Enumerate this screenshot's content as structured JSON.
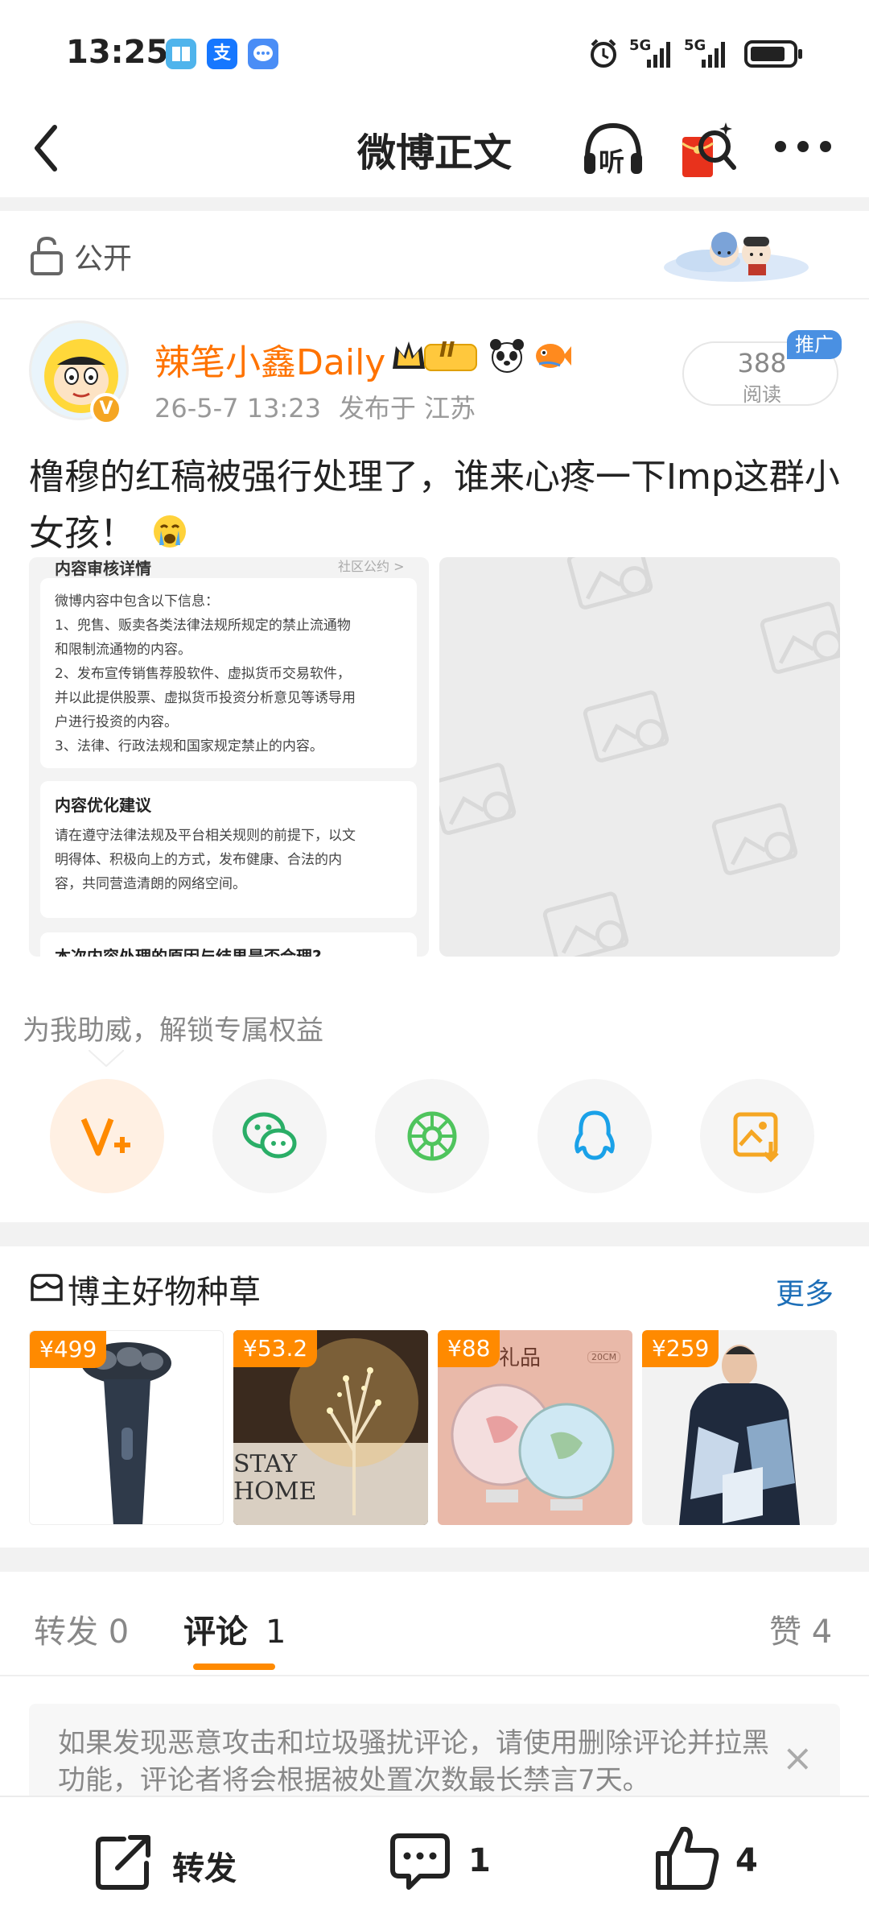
{
  "status_bar": {
    "time": "13:25",
    "app_icons": [
      {
        "name": "book-icon",
        "glyph": "▥",
        "color": "#4fb4ec"
      },
      {
        "name": "alipay-icon",
        "glyph": "支",
        "color": "#1677ff"
      },
      {
        "name": "message-icon",
        "glyph": "…",
        "color": "#4a8df6"
      }
    ],
    "network_1": "5G",
    "network_2": "5G"
  },
  "navbar": {
    "title": "微博正文",
    "listen_label": "听"
  },
  "post": {
    "visibility": "公开",
    "author": "辣笔小鑫Daily",
    "level_badge": "II",
    "date": "26-5-7 13:23",
    "location": "发布于 江苏",
    "read_count": "388",
    "read_label": "阅读",
    "promo_tag": "推广",
    "text": "橹穆的红稿被强行处理了，谁来心疼一下Imp这群小女孩！",
    "image_left": {
      "header_text": "内容审核详情",
      "header_link": "社区公约 >",
      "card1_lines": [
        "微博内容中包含以下信息：",
        "1、兜售、贩卖各类法律法规所规定的禁止流通物",
        "和限制流通物的内容。",
        "2、发布宣传销售荐股软件、虚拟货币交易软件，",
        "并以此提供股票、虚拟货币投资分析意见等诱导用",
        "户进行投资的内容。",
        "3、法律、行政法规和国家规定禁止的内容。"
      ],
      "card2_title": "内容优化建议",
      "card2_lines": [
        "请在遵守法律法规及平台相关规则的前提下，以文",
        "明得体、积极向上的方式，发布健康、合法的内",
        "容，共同营造清朗的网络空间。"
      ],
      "card3_title": "本次内容处理的原因与结果是否合理?"
    }
  },
  "boost": {
    "text": "为我助威，解锁专属权益"
  },
  "goods": {
    "title": "博主好物种草",
    "more": "更多",
    "items": [
      {
        "price": "¥499"
      },
      {
        "price": "¥53.2",
        "overlay_text": "STAY HOME"
      },
      {
        "price": "¥88",
        "overlay_text": "礼品",
        "size_tag": "20CM"
      },
      {
        "price": "¥259"
      }
    ]
  },
  "tabs": {
    "repost": "转发 0",
    "comment_label": "评论",
    "comment_count": "1",
    "like": "赞 4"
  },
  "notice": {
    "text": "如果发现恶意攻击和垃圾骚扰评论，请使用删除评论并拉黑功能，评论者将会根据被处置次数最长禁言7天。",
    "close": "×"
  },
  "bottom_bar": {
    "repost_label": "转发",
    "comment_count": "1",
    "like_count": "4"
  },
  "colors": {
    "accent": "#ff8a00",
    "username": "#ff7300",
    "link": "#1e6fb8"
  }
}
